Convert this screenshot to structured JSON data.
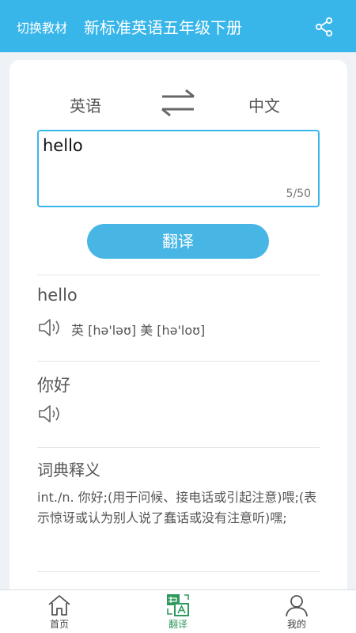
{
  "header": {
    "switch_label": "切换教材",
    "title": "新标准英语五年级下册",
    "share_icon": "share-icon"
  },
  "languages": {
    "source": "英语",
    "target": "中文",
    "swap_icon": "swap-arrows-icon"
  },
  "input": {
    "value": "hello",
    "char_count": "5/50"
  },
  "translate_button": "翻译",
  "result": {
    "word": "hello",
    "phonetic": "英 [hə'ləʊ]  美 [hə'loʊ]",
    "translation": "你好"
  },
  "dictionary": {
    "title": "词典释义",
    "definition": "int./n. 你好;(用于问候、接电话或引起注意)喂;(表示惊讶或认为别人说了蠢话或没有注意听)嘿;"
  },
  "tabs": [
    {
      "label": "首页",
      "icon": "home-icon"
    },
    {
      "label": "翻译",
      "icon": "translate-icon"
    },
    {
      "label": "我的",
      "icon": "user-icon"
    }
  ],
  "colors": {
    "primary": "#38b6ea",
    "active_tab": "#2e9a5e",
    "text": "#555555"
  }
}
